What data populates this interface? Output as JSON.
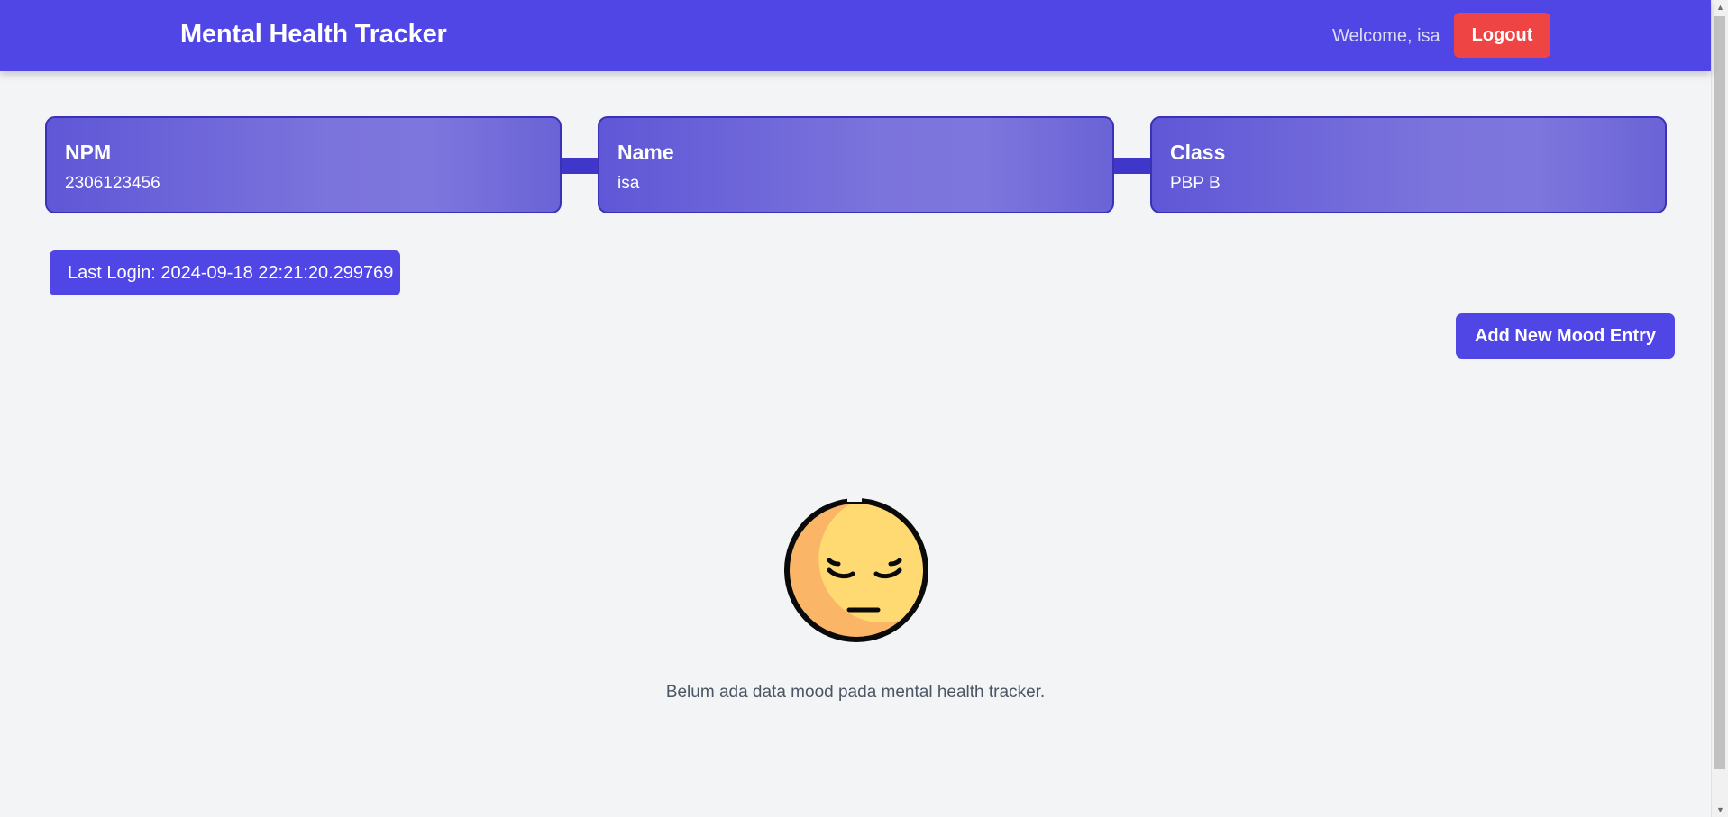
{
  "header": {
    "title": "Mental Health Tracker",
    "welcome_text": "Welcome, isa",
    "logout_label": "Logout"
  },
  "info_cards": [
    {
      "title": "NPM",
      "value": "2306123456"
    },
    {
      "title": "Name",
      "value": "isa"
    },
    {
      "title": "Class",
      "value": "PBP B"
    }
  ],
  "last_login": "Last Login: 2024-09-18 22:21:20.299769",
  "add_button_label": "Add New Mood Entry",
  "empty_state": {
    "icon": "sad-face-icon",
    "message": "Belum ada data mood pada mental health tracker."
  },
  "colors": {
    "primary": "#4f46e5",
    "danger": "#ef4444",
    "background": "#f3f4f6",
    "card_border": "#3b31b8"
  }
}
